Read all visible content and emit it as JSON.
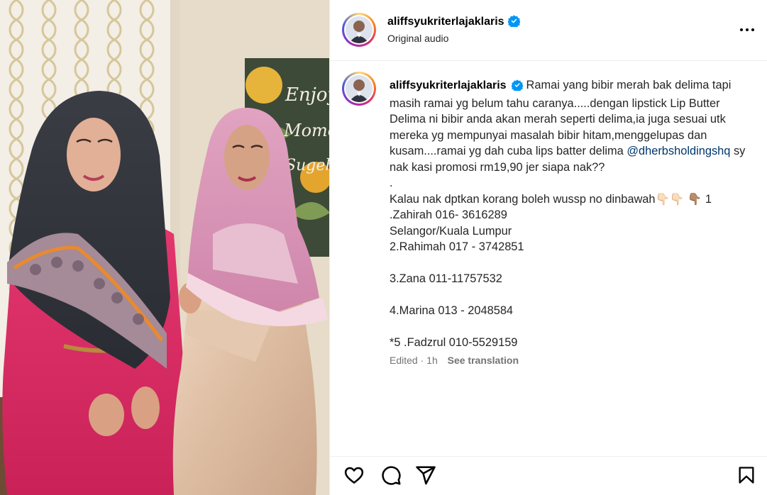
{
  "post": {
    "username": "aliffsyukriterlajaklaris",
    "audio_label": "Original audio",
    "caption": {
      "username": "aliffsyukriterlajaklaris",
      "text_part1": "Ramai yang bibir merah bak delima tapi masih ramai yg belum tahu caranya.....dengan lipstick Lip Butter Delima ni bibir anda akan merah seperti delima,ia juga sesuai utk mereka yg mempunyai masalah bibir hitam,menggelupas dan kusam....ramai yg dah cuba lips batter delima ",
      "mention": "@dherbsholdingshq",
      "text_part2": " sy nak kasi promosi rm19,90 jer siapa nak??\n.\nKalau nak dptkan korang boleh wussp no dinbawah👇🏻👇🏻 👇🏽 1\n.Zahirah 016- 3616289\nSelangor/Kuala Lumpur\n2.Rahimah 017 - 3742851\n\n3.Zana 011-11757532\n\n4.Marina 013 - 2048584\n\n*5 .Fadzrul 010-5529159"
    },
    "edited_label": "Edited",
    "dot": "·",
    "time_ago": "1h",
    "see_translation": "See translation"
  },
  "media": {
    "poster_text": [
      "Enjoy",
      "Mome",
      "Sugeh"
    ]
  },
  "icons": {
    "verified": "verified-badge-icon",
    "more": "more-options-icon",
    "like": "heart-icon",
    "comment": "comment-icon",
    "share": "share-icon",
    "save": "bookmark-icon"
  },
  "colors": {
    "verified_blue": "#0095f6",
    "mention": "#00376b",
    "muted": "#737373"
  }
}
